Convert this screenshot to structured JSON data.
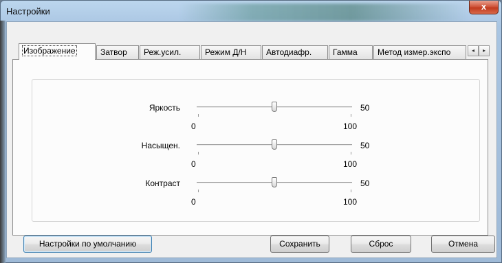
{
  "window": {
    "title": "Настройки",
    "close_glyph": "x"
  },
  "tabs": [
    {
      "label": "Изображение",
      "active": true
    },
    {
      "label": "Затвор",
      "active": false
    },
    {
      "label": "Реж.усил.",
      "active": false
    },
    {
      "label": "Режим Д/Н",
      "active": false
    },
    {
      "label": "Автодиафр.",
      "active": false
    },
    {
      "label": "Гамма",
      "active": false
    },
    {
      "label": "Метод измер.экспо",
      "active": false
    }
  ],
  "tab_scroll": {
    "left_glyph": "◂",
    "right_glyph": "▸"
  },
  "sliders": [
    {
      "label": "Яркость",
      "value": "50",
      "min": "0",
      "max": "100",
      "position": 0.5
    },
    {
      "label": "Насыщен.",
      "value": "50",
      "min": "0",
      "max": "100",
      "position": 0.5
    },
    {
      "label": "Контраст",
      "value": "50",
      "min": "0",
      "max": "100",
      "position": 0.5
    }
  ],
  "buttons": {
    "defaults": "Настройки по умолчанию",
    "save": "Сохранить",
    "reset": "Сброс",
    "cancel": "Отмена"
  },
  "colors": {
    "focus_border": "#3c7fb1",
    "close_red": "#c13a1e"
  },
  "icons": [
    "close-icon",
    "scroll-left-icon",
    "scroll-right-icon"
  ]
}
